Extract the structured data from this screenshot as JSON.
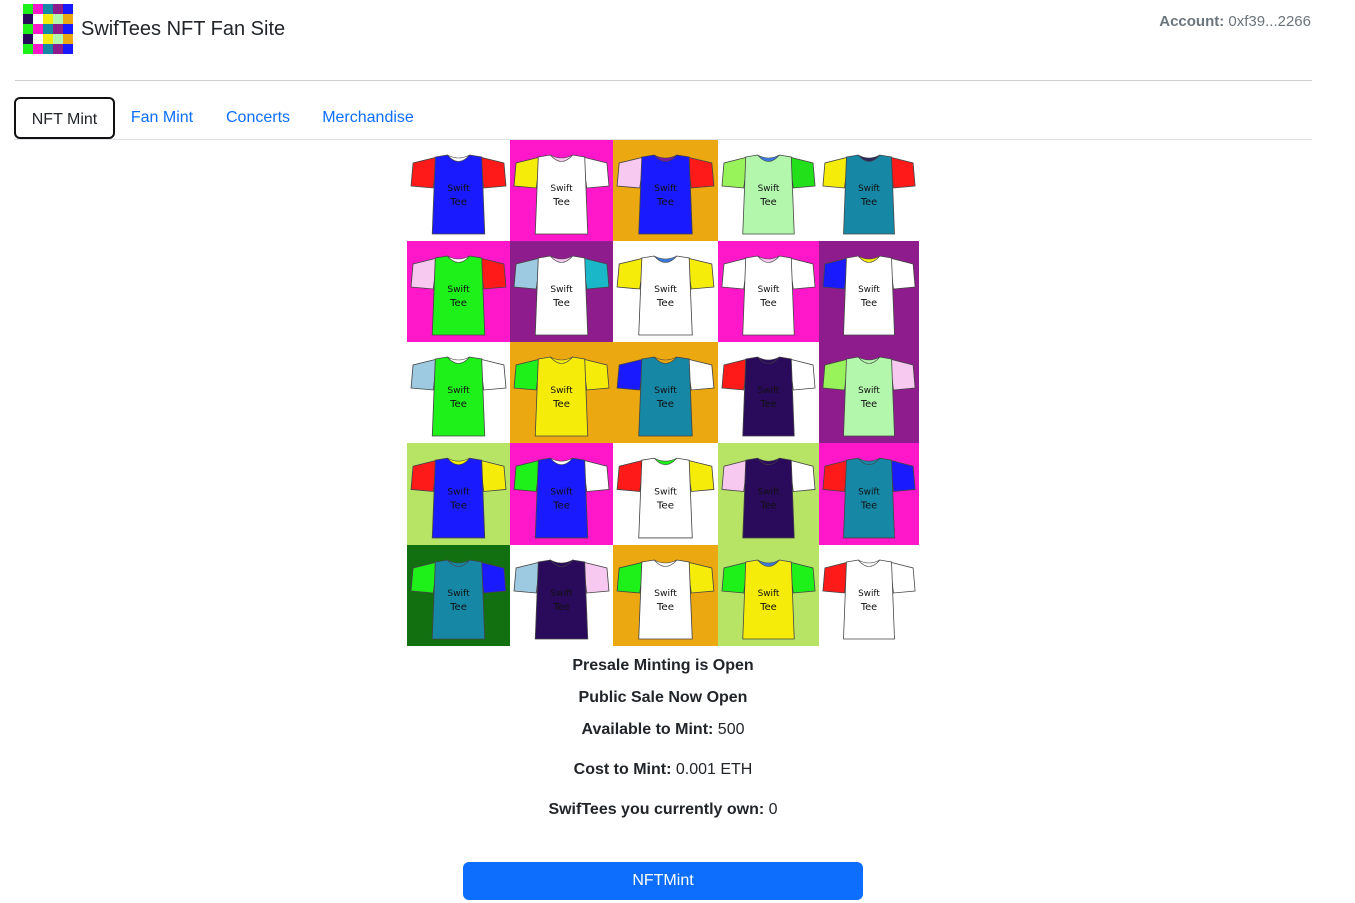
{
  "header": {
    "title": "SwifTees NFT Fan Site",
    "account_label": "Account:",
    "account_value": "0xf39...2266",
    "logo_icon": "swiftees-logo-icon"
  },
  "tabs": [
    {
      "label": "NFT Mint",
      "active": true
    },
    {
      "label": "Fan Mint",
      "active": false
    },
    {
      "label": "Concerts",
      "active": false
    },
    {
      "label": "Merchandise",
      "active": false
    }
  ],
  "tee_text": {
    "line1": "Swift",
    "line2": "Tee"
  },
  "gallery": [
    {
      "bg": "#ffffff",
      "body": "#1a1aff",
      "left": "#ff1a1a",
      "right": "#ff1a1a",
      "collar": "#ffffff"
    },
    {
      "bg": "#ff17c9",
      "body": "#ffffff",
      "left": "#f5ec0a",
      "right": "#ffffff",
      "collar": "#f7c8f0"
    },
    {
      "bg": "#eba810",
      "body": "#1a1aff",
      "left": "#f7c8f0",
      "right": "#ff1a1a",
      "collar": "#7a1aa0"
    },
    {
      "bg": "#ffffff",
      "body": "#b3f7ad",
      "left": "#98f25a",
      "right": "#22e01a",
      "collar": "#3a7ae0"
    },
    {
      "bg": "#ffffff",
      "body": "#1687a5",
      "left": "#f5ec0a",
      "right": "#ff1a1a",
      "collar": "#2a2a60"
    },
    {
      "bg": "#ff17c9",
      "body": "#1ef01a",
      "left": "#f7c8f0",
      "right": "#ff1a1a",
      "collar": "#ffffff"
    },
    {
      "bg": "#8e1c8c",
      "body": "#ffffff",
      "left": "#9ecae1",
      "right": "#1ab7c9",
      "collar": "#f7c8f0"
    },
    {
      "bg": "#ffffff",
      "body": "#ffffff",
      "left": "#f5ec0a",
      "right": "#f5ec0a",
      "collar": "#3a7ae0"
    },
    {
      "bg": "#ff17c9",
      "body": "#ffffff",
      "left": "#ffffff",
      "right": "#ffffff",
      "collar": "#f7c8f0"
    },
    {
      "bg": "#8e1c8c",
      "body": "#ffffff",
      "left": "#1a1aff",
      "right": "#ffffff",
      "collar": "#f5ec0a"
    },
    {
      "bg": "#ffffff",
      "body": "#1ef01a",
      "left": "#9ecae1",
      "right": "#ffffff",
      "collar": "#ffffff"
    },
    {
      "bg": "#eba810",
      "body": "#f5ec0a",
      "left": "#1ef01a",
      "right": "#f5ec0a",
      "collar": "#f5ec0a"
    },
    {
      "bg": "#eba810",
      "body": "#1687a5",
      "left": "#1a1aff",
      "right": "#ffffff",
      "collar": "#eba810"
    },
    {
      "bg": "#ffffff",
      "body": "#2a0a5a",
      "left": "#ff1a1a",
      "right": "#ffffff",
      "collar": "#2a0a5a"
    },
    {
      "bg": "#8e1c8c",
      "body": "#b3f7ad",
      "left": "#98f25a",
      "right": "#f7c8f0",
      "collar": "#b3f7ad"
    },
    {
      "bg": "#b8e466",
      "body": "#1a1aff",
      "left": "#ff1a1a",
      "right": "#f5ec0a",
      "collar": "#f5ec0a"
    },
    {
      "bg": "#ff17c9",
      "body": "#1a1aff",
      "left": "#1ef01a",
      "right": "#ffffff",
      "collar": "#ffffff"
    },
    {
      "bg": "#ffffff",
      "body": "#ffffff",
      "left": "#ff1a1a",
      "right": "#f5ec0a",
      "collar": "#1ef01a"
    },
    {
      "bg": "#b8e466",
      "body": "#2a0a5a",
      "left": "#f7c8f0",
      "right": "#ffffff",
      "collar": "#2a0a5a"
    },
    {
      "bg": "#ff17c9",
      "body": "#1687a5",
      "left": "#ff1a1a",
      "right": "#1a1aff",
      "collar": "#1687a5"
    },
    {
      "bg": "#127010",
      "body": "#1687a5",
      "left": "#1ef01a",
      "right": "#1a1aff",
      "collar": "#1687a5"
    },
    {
      "bg": "#ffffff",
      "body": "#2a0a5a",
      "left": "#9ecae1",
      "right": "#f7c8f0",
      "collar": "#2a0a5a"
    },
    {
      "bg": "#eba810",
      "body": "#ffffff",
      "left": "#1ef01a",
      "right": "#f5ec0a",
      "collar": "#ffffff"
    },
    {
      "bg": "#b8e466",
      "body": "#f5ec0a",
      "left": "#1ef01a",
      "right": "#1ef01a",
      "collar": "#3a7ae0"
    },
    {
      "bg": "#ffffff",
      "body": "#ffffff",
      "left": "#ff1a1a",
      "right": "#ffffff",
      "collar": "#ffffff"
    }
  ],
  "status": {
    "presale": "Presale Minting is Open",
    "public_sale": "Public Sale Now Open",
    "available_label": "Available to Mint:",
    "available_value": "500",
    "cost_label": "Cost to Mint:",
    "cost_value": "0.001 ETH",
    "owned_label": "SwifTees you currently own:",
    "owned_value": "0"
  },
  "mint_button_label": "NFTMint",
  "colors": {
    "accent": "#0d6efd"
  }
}
